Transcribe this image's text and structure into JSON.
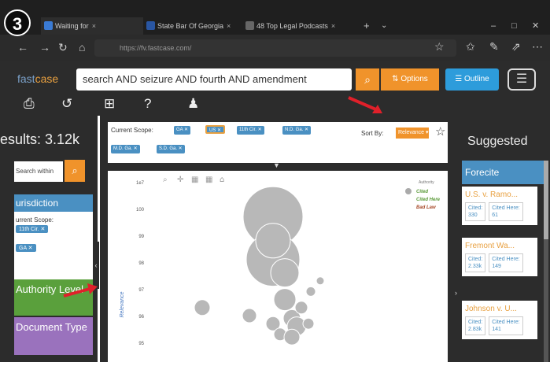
{
  "step_badge": "3",
  "tabs": [
    {
      "label": "Waiting for",
      "icon": "page-icon"
    },
    {
      "label": "State Bar Of Georgia",
      "icon": "bar-icon"
    },
    {
      "label": "48 Top Legal Podcasts",
      "icon": "podcast-icon"
    }
  ],
  "addressbar": {
    "url": "https://fv.fastcase.com/"
  },
  "app": {
    "logo_a": "fast",
    "logo_b": "case",
    "search_query": "search AND seizure AND fourth AND amendment",
    "options_label": "Options",
    "outline_label": "Outline"
  },
  "left": {
    "results": "esults: 3.12k",
    "search_within_placeholder": "Search within",
    "jurisdiction": "urisdiction",
    "current_scope": "urrent Scope:",
    "authority": "Authority Level",
    "doctype": "Document Type"
  },
  "scope": {
    "label": "Current Scope:",
    "tags": [
      "GA",
      "US",
      "11th Cir.",
      "N.D. Ga.",
      "M.D. Ga.",
      "S.D. Ga."
    ],
    "sort_by": "Sort By:",
    "sort_value": "Relevance"
  },
  "chart_data": {
    "type": "scatter",
    "title": "",
    "xlabel": "",
    "ylabel": "Relevance",
    "y_ticks": [
      "1e7",
      "100",
      "99",
      "98",
      "97",
      "96",
      "95"
    ],
    "legend": {
      "title": "Authority",
      "items": [
        "Cited",
        "Cited Here",
        "Bad Law"
      ],
      "placement": "top-right"
    },
    "points": [
      {
        "x": 0.5,
        "y": 99.2,
        "size": 38
      },
      {
        "x": 0.5,
        "y": 97.6,
        "size": 34
      },
      {
        "x": 0.5,
        "y": 98.3,
        "size": 22
      },
      {
        "x": 0.55,
        "y": 97.1,
        "size": 18
      },
      {
        "x": 0.2,
        "y": 95.8,
        "size": 10
      },
      {
        "x": 0.4,
        "y": 95.5,
        "size": 9
      },
      {
        "x": 0.55,
        "y": 96.1,
        "size": 14
      },
      {
        "x": 0.58,
        "y": 95.4,
        "size": 11
      },
      {
        "x": 0.62,
        "y": 95.8,
        "size": 8
      },
      {
        "x": 0.66,
        "y": 96.4,
        "size": 6
      },
      {
        "x": 0.7,
        "y": 96.8,
        "size": 5
      },
      {
        "x": 0.6,
        "y": 95.1,
        "size": 12
      },
      {
        "x": 0.5,
        "y": 95.2,
        "size": 9
      },
      {
        "x": 0.65,
        "y": 95.2,
        "size": 7
      },
      {
        "x": 0.53,
        "y": 94.8,
        "size": 8
      },
      {
        "x": 0.58,
        "y": 94.7,
        "size": 10
      }
    ]
  },
  "right": {
    "suggested": "Suggested",
    "forecite": "Forecite",
    "cards": [
      {
        "title": "U.S. v. Ramo...",
        "cited_label": "Cited:",
        "cited": "330",
        "here_label": "Cited Here:",
        "here": "61"
      },
      {
        "title": "Fremont Wa...",
        "cited_label": "Cited:",
        "cited": "2.33k",
        "here_label": "Cited Here:",
        "here": "149"
      },
      {
        "title": "Johnson v. U...",
        "cited_label": "Cited:",
        "cited": "2.83k",
        "here_label": "Cited Here:",
        "here": "141"
      }
    ]
  },
  "colors": {
    "orange": "#f0932b",
    "blue": "#4a90c2",
    "green": "#5aa03c",
    "purple": "#9a72bd",
    "arrow": "#e0202a"
  }
}
